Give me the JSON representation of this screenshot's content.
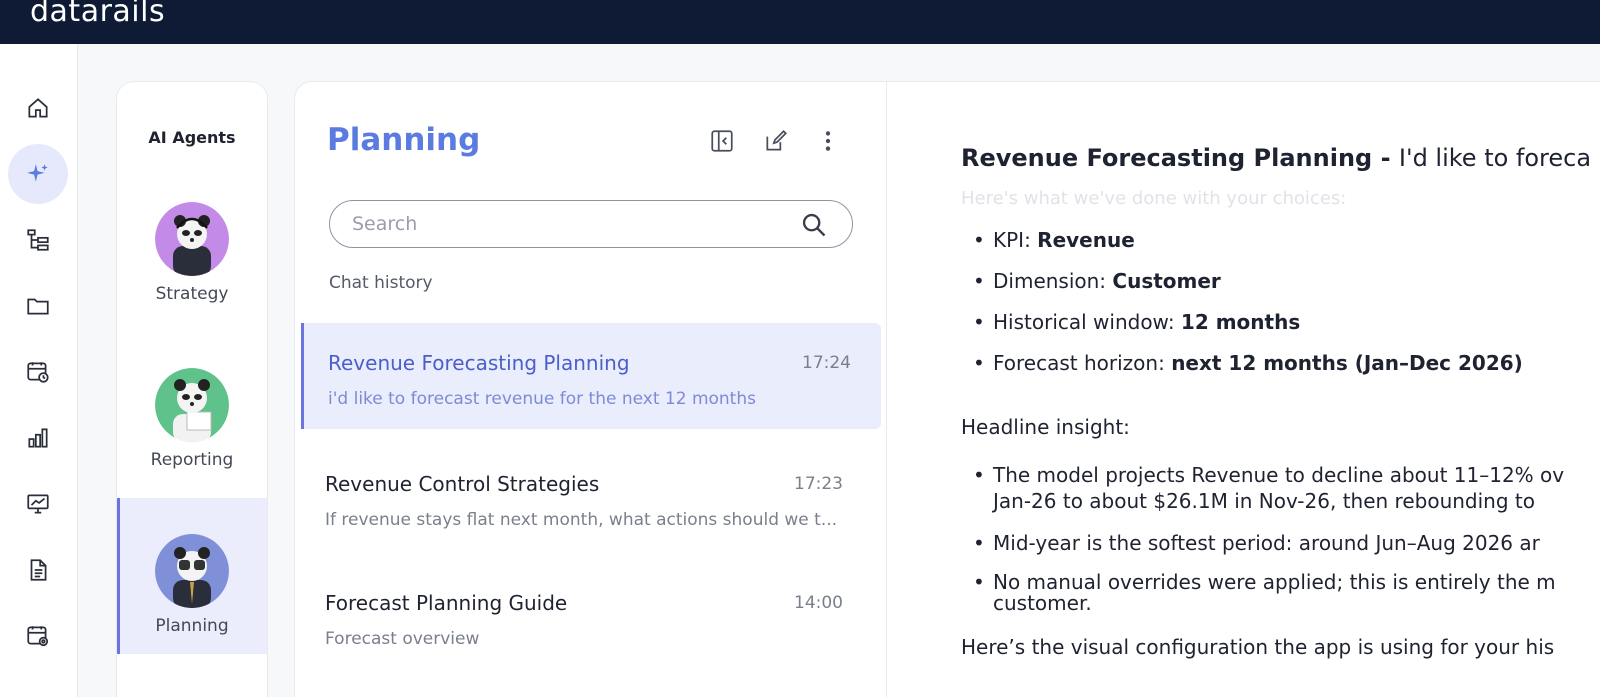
{
  "app": {
    "logo_text": "datarails"
  },
  "agents": {
    "title": "AI Agents",
    "items": [
      {
        "name": "Strategy",
        "color": "#c48ae8"
      },
      {
        "name": "Reporting",
        "color": "#5fc28a"
      },
      {
        "name": "Planning",
        "color": "#7f8fd8"
      }
    ]
  },
  "planning": {
    "title": "Planning",
    "search_placeholder": "Search",
    "history_label": "Chat history",
    "chats": [
      {
        "title": "Revenue Forecasting Planning",
        "time": "17:24",
        "subtitle": "i'd like to forecast revenue for the next 12 months"
      },
      {
        "title": "Revenue Control Strategies",
        "time": "17:23",
        "subtitle": "If revenue stays flat next month, what actions should we t..."
      },
      {
        "title": "Forecast Planning Guide",
        "time": "14:00",
        "subtitle": "Forecast overview"
      }
    ]
  },
  "message": {
    "title_bold": "Revenue Forecasting Planning - ",
    "title_rest": "I'd like to foreca",
    "faded_line": "Here's what we've done with your choices:",
    "choices": [
      {
        "label": "KPI: ",
        "value": "Revenue"
      },
      {
        "label": "Dimension: ",
        "value": "Customer"
      },
      {
        "label": "Historical window: ",
        "value": "12 months"
      },
      {
        "label": "Forecast horizon: ",
        "value": "next 12 months (Jan–Dec 2026)"
      }
    ],
    "headline_label": "Headline insight:",
    "insights": [
      {
        "line1": "The model projects Revenue to decline about 11–12% ov",
        "line2": "Jan-26 to about $26.1M in Nov-26, then rebounding to"
      },
      {
        "line1": "Mid-year is the softest period: around Jun–Aug 2026 ar"
      },
      {
        "line1": "No manual overrides were applied; this is entirely the m",
        "line2": "customer."
      }
    ],
    "footer_line": "Here’s the visual configuration the app is using for your his"
  },
  "colors": {
    "accent": "#5b7be0",
    "topbar": "#0f1b35",
    "active_bg": "#e9edfc"
  }
}
